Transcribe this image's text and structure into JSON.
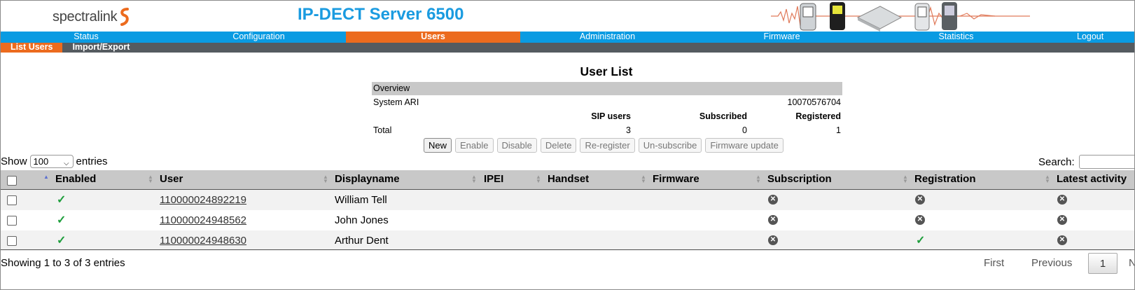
{
  "header": {
    "logo_text": "spectralink",
    "product_title": "IP-DECT Server 6500"
  },
  "main_nav": [
    {
      "label": "Status",
      "active": false
    },
    {
      "label": "Configuration",
      "active": false
    },
    {
      "label": "Users",
      "active": true
    },
    {
      "label": "Administration",
      "active": false
    },
    {
      "label": "Firmware",
      "active": false
    },
    {
      "label": "Statistics",
      "active": false
    },
    {
      "label": "Logout",
      "active": false
    }
  ],
  "sub_nav": [
    {
      "label": "List Users",
      "active": true
    },
    {
      "label": "Import/Export",
      "active": false
    }
  ],
  "page_title": "User List",
  "overview": {
    "heading": "Overview",
    "system_ari_label": "System ARI",
    "system_ari_value": "10070576704",
    "col_sip_users": "SIP users",
    "col_subscribed": "Subscribed",
    "col_registered": "Registered",
    "total_label": "Total",
    "total_sip_users": "3",
    "total_subscribed": "0",
    "total_registered": "1"
  },
  "buttons": {
    "new": "New",
    "enable": "Enable",
    "disable": "Disable",
    "delete": "Delete",
    "reregister": "Re-register",
    "unsubscribe": "Un-subscribe",
    "firmware_update": "Firmware update"
  },
  "length_menu": {
    "prefix": "Show",
    "value": "100",
    "suffix": "entries"
  },
  "search": {
    "label": "Search:",
    "value": ""
  },
  "table": {
    "columns": [
      "Enabled",
      "User",
      "Displayname",
      "IPEI",
      "Handset",
      "Firmware",
      "Subscription",
      "Registration",
      "Latest activity"
    ],
    "rows": [
      {
        "enabled": true,
        "user": "110000024892219",
        "displayname": "William Tell",
        "ipei": "",
        "handset": "",
        "firmware": "",
        "subscription": false,
        "registration": false,
        "latest_activity": false
      },
      {
        "enabled": true,
        "user": "110000024948562",
        "displayname": "John Jones",
        "ipei": "",
        "handset": "",
        "firmware": "",
        "subscription": false,
        "registration": false,
        "latest_activity": false
      },
      {
        "enabled": true,
        "user": "110000024948630",
        "displayname": "Arthur Dent",
        "ipei": "",
        "handset": "",
        "firmware": "",
        "subscription": false,
        "registration": true,
        "latest_activity": false
      }
    ]
  },
  "info_text": "Showing 1 to 3 of 3 entries",
  "pager": {
    "first": "First",
    "previous": "Previous",
    "current_page": "1",
    "next": "Next"
  },
  "icons": {
    "enabled_check": "check-icon",
    "status_no": "x-circle-icon",
    "status_yes": "check-icon"
  },
  "colors": {
    "brand_blue": "#0a9be2",
    "active_orange": "#ec6b1e",
    "subnav_gray": "#555b60",
    "check_green": "#1e9e3c"
  }
}
